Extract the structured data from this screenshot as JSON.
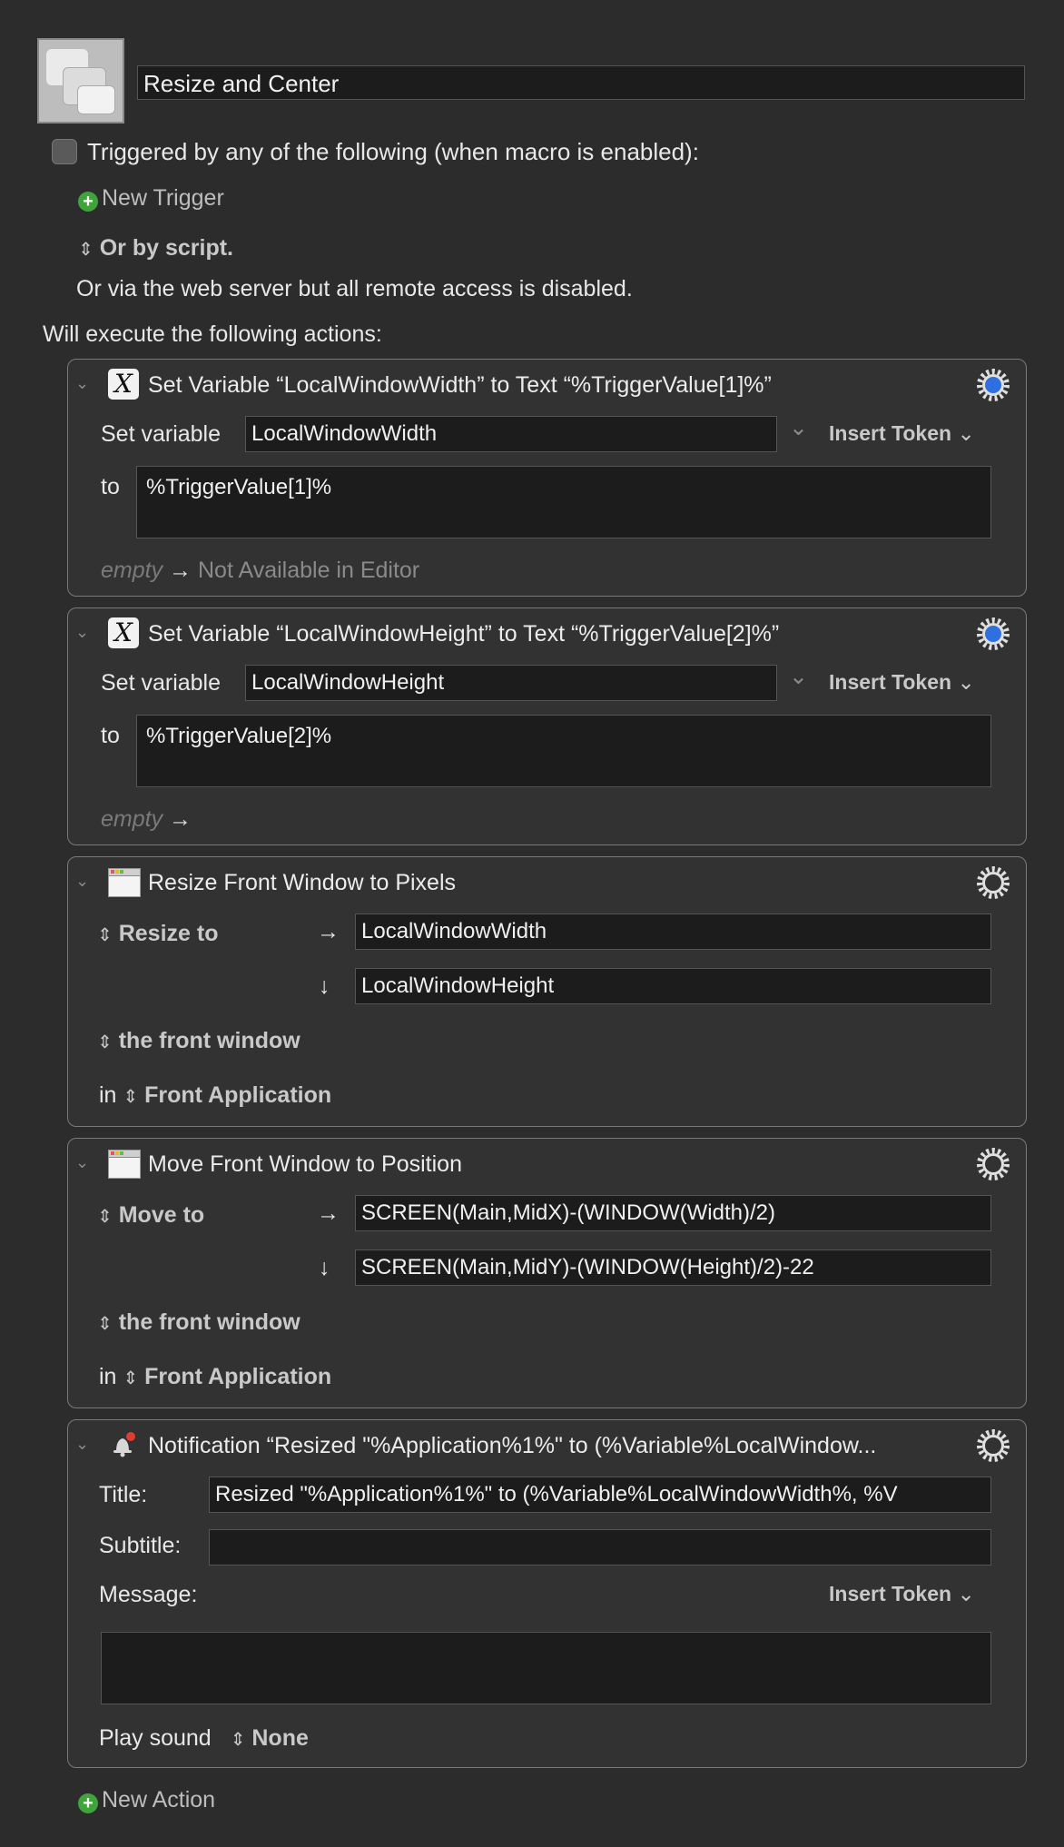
{
  "macro": {
    "name": "Resize and Center",
    "trigger_label": "Triggered by any of the following (when macro is enabled):",
    "new_trigger": "New Trigger",
    "or_by_script": "Or by script.",
    "web_server_note": "Or via the web server but all remote access is disabled.",
    "will_execute": "Will execute the following actions:",
    "new_action": "New Action"
  },
  "actions": {
    "a1": {
      "title": "Set Variable “LocalWindowWidth” to Text “%TriggerValue[1]%”",
      "set_variable_label": "Set variable",
      "variable": "LocalWindowWidth",
      "insert_token": "Insert Token",
      "to_label": "to",
      "text": "%TriggerValue[1]%",
      "empty": "empty",
      "arrow": "→",
      "result": "Not Available in Editor"
    },
    "a2": {
      "title": "Set Variable “LocalWindowHeight” to Text “%TriggerValue[2]%”",
      "set_variable_label": "Set variable",
      "variable": "LocalWindowHeight",
      "insert_token": "Insert Token",
      "to_label": "to",
      "text": "%TriggerValue[2]%",
      "empty": "empty",
      "arrow": "→"
    },
    "a3": {
      "title": "Resize Front Window to Pixels",
      "mode": "Resize to",
      "width": "LocalWindowWidth",
      "height": "LocalWindowHeight",
      "window": "the front window",
      "in_label": "in",
      "application": "Front Application"
    },
    "a4": {
      "title": "Move Front Window to Position",
      "mode": "Move to",
      "x": "SCREEN(Main,MidX)-(WINDOW(Width)/2)",
      "y": "SCREEN(Main,MidY)-(WINDOW(Height)/2)-22",
      "window": "the front window",
      "in_label": "in",
      "application": "Front Application"
    },
    "a5": {
      "title": "Notification “Resized \"%Application%1%\" to (%Variable%LocalWindow...",
      "title_label": "Title:",
      "title_value": "Resized \"%Application%1%\" to (%Variable%LocalWindowWidth%, %V",
      "subtitle_label": "Subtitle:",
      "subtitle_value": "",
      "message_label": "Message:",
      "insert_token": "Insert Token",
      "message_value": "",
      "play_sound_label": "Play sound",
      "sound": "None"
    }
  },
  "glyphs": {
    "disclosure": "⌄",
    "updown": "⇕",
    "right_arrow": "→",
    "down_arrow": "↓",
    "chevron": "⌄"
  },
  "colors": {
    "accent_blue": "#2f6fe0",
    "plus_green": "#3fa53a",
    "background": "#2c2c2c"
  }
}
